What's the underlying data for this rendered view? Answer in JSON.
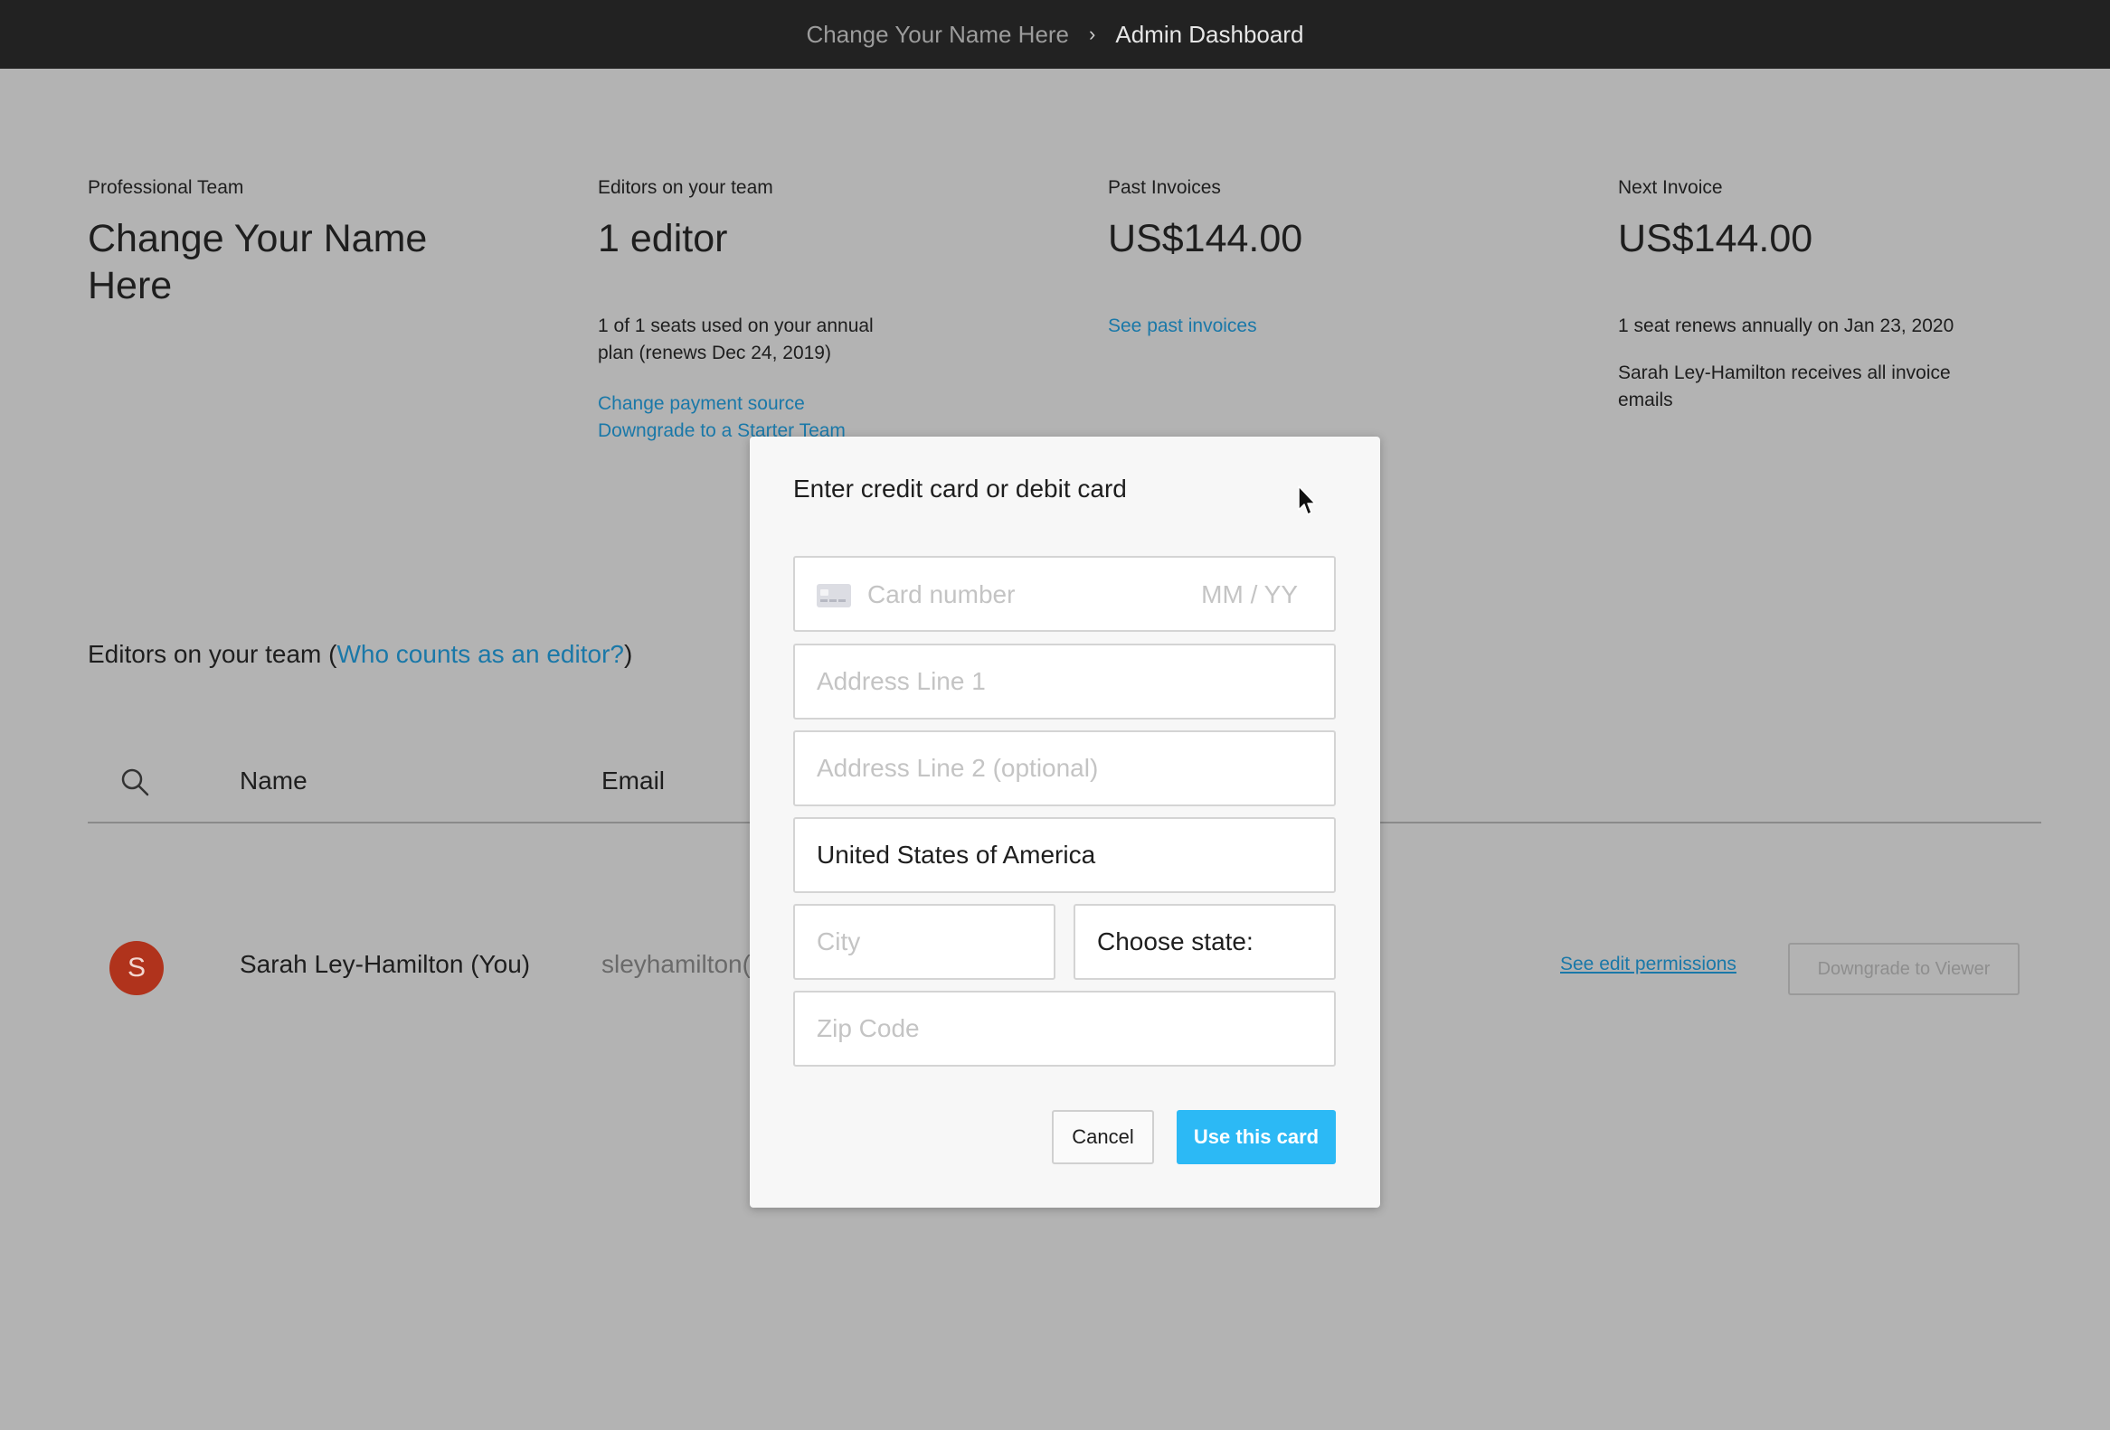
{
  "breadcrumb": {
    "team": "Change Your Name Here",
    "separator": "›",
    "page": "Admin Dashboard"
  },
  "summary": {
    "team": {
      "label": "Professional Team",
      "name": "Change Your Name Here"
    },
    "editors": {
      "label": "Editors on your team",
      "count": "1 editor",
      "seats_text": "1 of 1 seats used on your annual plan (renews Dec 24, 2019)",
      "change_payment": "Change payment source",
      "downgrade_starter": "Downgrade to a Starter Team"
    },
    "past_invoices": {
      "label": "Past Invoices",
      "amount": "US$144.00",
      "link": "See past invoices"
    },
    "next_invoice": {
      "label": "Next Invoice",
      "amount": "US$144.00",
      "renew_text": "1 seat renews annually on Jan 23, 2020",
      "email_text": "Sarah Ley-Hamilton receives all invoice emails"
    }
  },
  "editors_section": {
    "title_prefix": "Editors on your team (",
    "title_link": "Who counts as an editor?",
    "title_suffix": ")",
    "columns": {
      "name": "Name",
      "email": "Email"
    },
    "rows": [
      {
        "avatar": "S",
        "name": "Sarah Ley-Hamilton (You)",
        "email": "sleyhamilton(",
        "permissions_link": "See edit permissions",
        "downgrade_label": "Downgrade to Viewer"
      }
    ]
  },
  "modal": {
    "title": "Enter credit card or debit card",
    "card_number_placeholder": "Card number",
    "expiry_placeholder": "MM / YY",
    "address1_placeholder": "Address Line 1",
    "address2_placeholder": "Address Line 2 (optional)",
    "country_value": "United States of America",
    "city_placeholder": "City",
    "state_value": "Choose state:",
    "zip_placeholder": "Zip Code",
    "cancel_label": "Cancel",
    "submit_label": "Use this card"
  },
  "colors": {
    "accent": "#2cb9f5",
    "link": "#1a78a8",
    "avatar": "#b0331c",
    "topbar": "#222222"
  }
}
